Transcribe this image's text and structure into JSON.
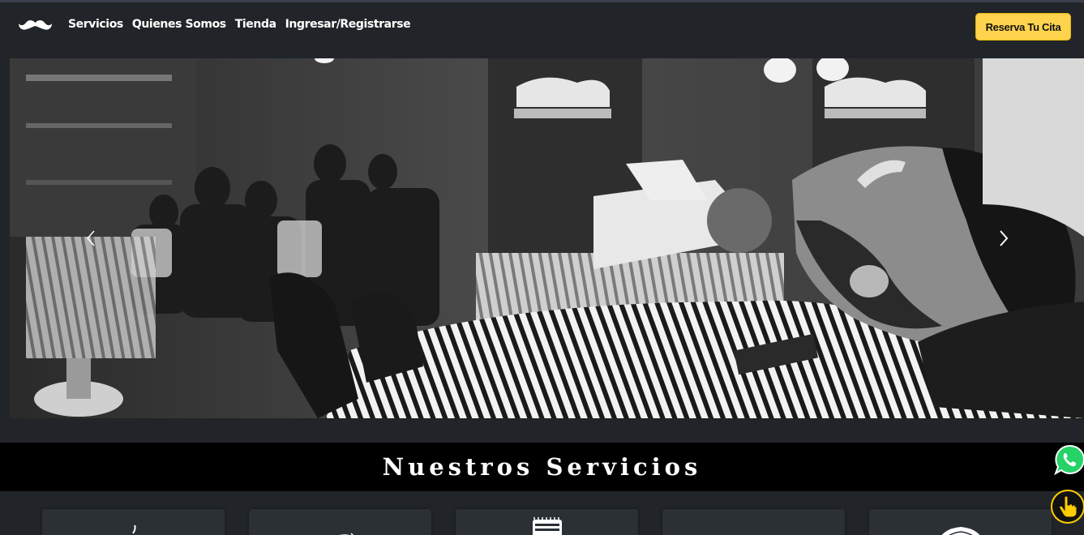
{
  "nav": {
    "logo": "mustache-icon",
    "links": [
      {
        "label": "Servicios"
      },
      {
        "label": "Quienes Somos"
      },
      {
        "label": "Tienda"
      },
      {
        "label": "Ingresar/Registrarse"
      }
    ],
    "cta_label": "Reserva Tu Cita"
  },
  "carousel": {
    "prev_icon": "chevron-left-icon",
    "next_icon": "chevron-right-icon"
  },
  "services": {
    "title": "Nuestros Servicios",
    "cards": [
      {
        "icon": "beard-icon"
      },
      {
        "icon": "razor-icon"
      },
      {
        "icon": "clipper-icon"
      },
      {
        "icon": "blank"
      },
      {
        "icon": "head-icon"
      }
    ]
  },
  "floating": {
    "whatsapp_icon": "whatsapp-icon",
    "accessibility_icon": "hand-pointer-icon"
  },
  "colors": {
    "background": "#212529",
    "accent": "#ffd34d",
    "band": "#000000",
    "whatsapp": "#25d366"
  }
}
